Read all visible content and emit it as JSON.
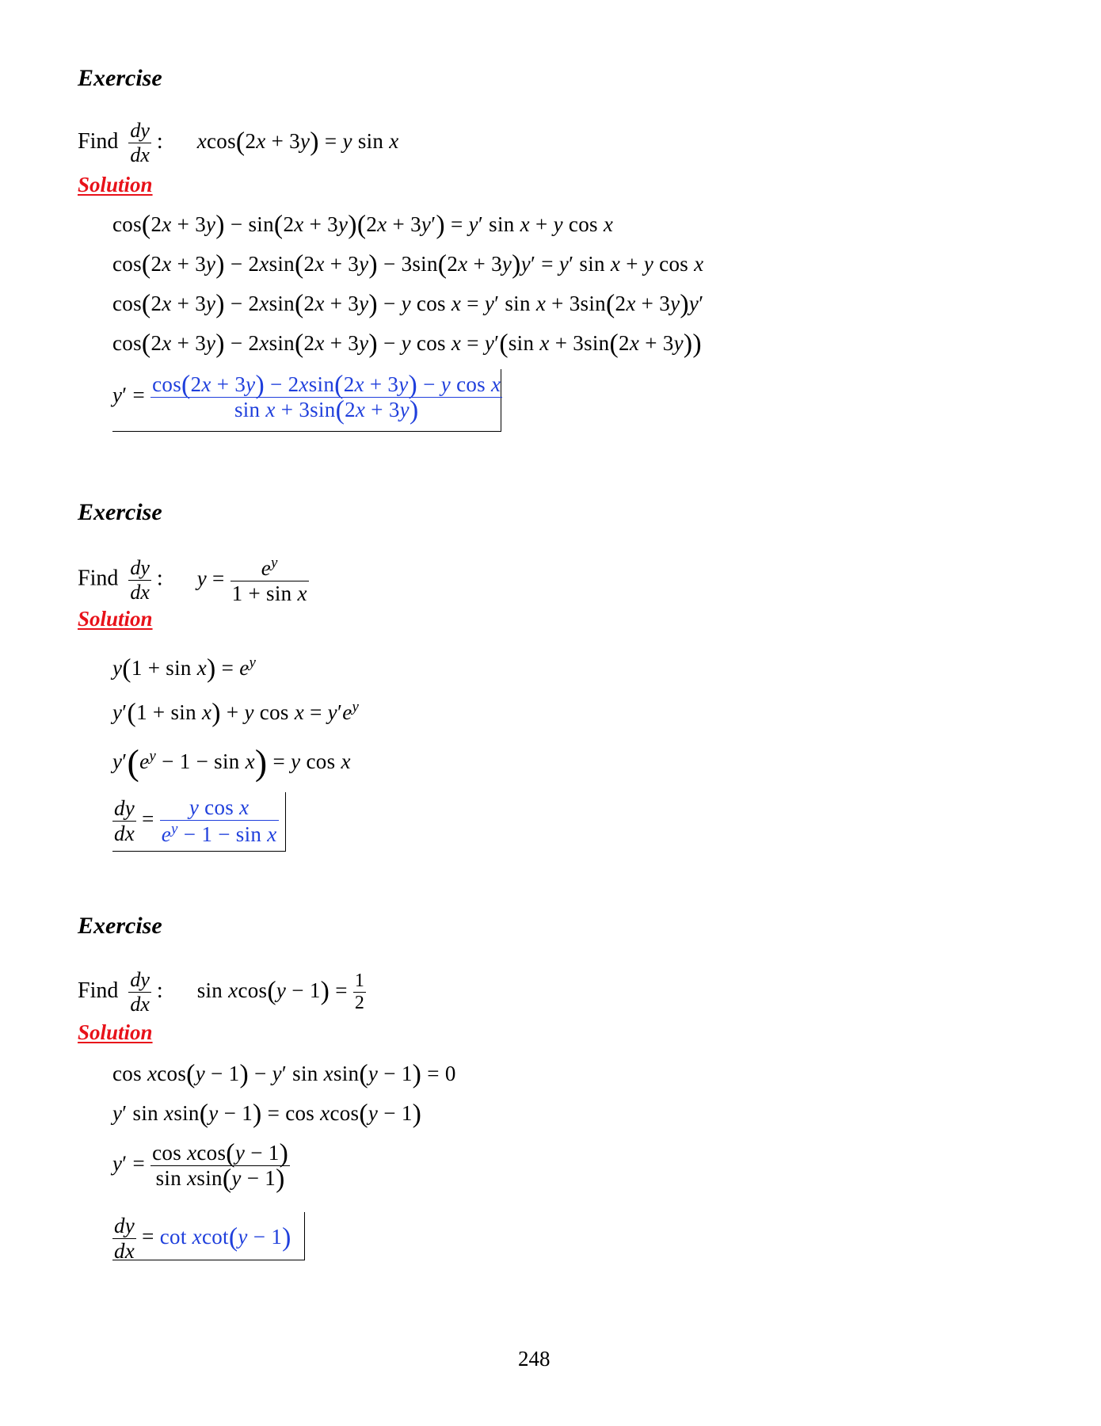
{
  "page_number": "248",
  "exercises": [
    {
      "heading": "Exercise",
      "find_label": "Find",
      "solution_label": "Solution"
    },
    {
      "heading": "Exercise",
      "find_label": "Find",
      "solution_label": "Solution"
    },
    {
      "heading": "Exercise",
      "find_label": "Find",
      "solution_label": "Solution"
    }
  ],
  "colors": {
    "solution": "#e8121a",
    "answer": "#1f3fdc"
  }
}
